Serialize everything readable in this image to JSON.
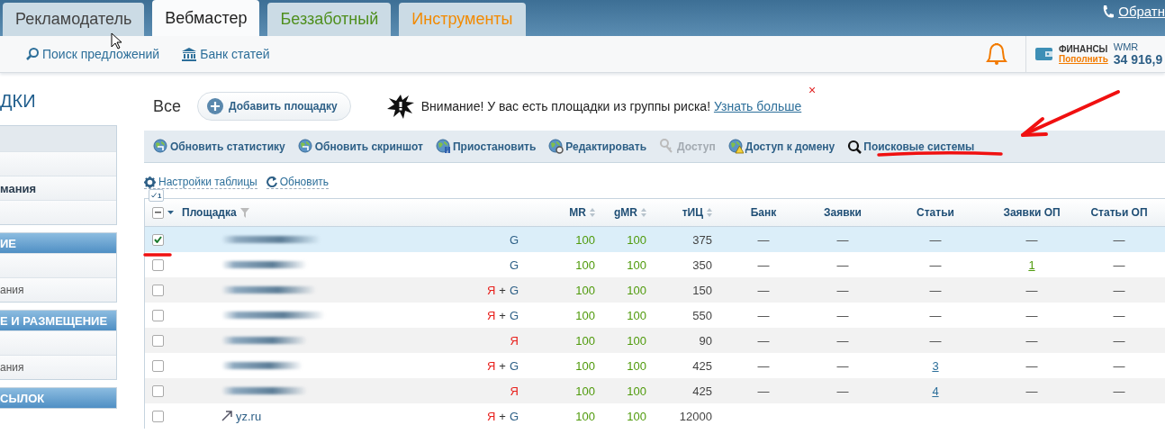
{
  "top_tabs": [
    {
      "label": "Рекламодатель",
      "selected": false,
      "kind": "plain"
    },
    {
      "label": "Вебмастер",
      "selected": true,
      "kind": "plain"
    },
    {
      "label": "Беззаботный",
      "selected": false,
      "kind": "green"
    },
    {
      "label": "Инструменты",
      "selected": false,
      "kind": "orange"
    }
  ],
  "callback_link": "Обратн",
  "subnav": [
    {
      "label": "Поиск предложений",
      "kind": "search"
    },
    {
      "label": "Банк статей",
      "kind": "bank"
    }
  ],
  "finance": {
    "title": "ФИНАНСЫ",
    "topup": "Пополнить",
    "currency": "WMR",
    "balance": "34 916,9"
  },
  "sidebar": {
    "heading": "ДКИ",
    "groups": [
      {
        "kind": "plain",
        "items": [
          {
            "kind": "head"
          },
          {
            "kind": "blank"
          },
          {
            "kind": "text",
            "label": "мания",
            "bold": true
          },
          {
            "kind": "blank"
          }
        ]
      },
      {
        "kind": "blue",
        "title": "ИЕ",
        "items": [
          {
            "kind": "blank"
          },
          {
            "kind": "text",
            "label": "ания",
            "bold": false
          }
        ]
      },
      {
        "kind": "blue",
        "title": "Е И РАЗМЕЩЕНИЕ",
        "items": [
          {
            "kind": "blank"
          },
          {
            "kind": "text",
            "label": "ания",
            "bold": false
          }
        ]
      },
      {
        "kind": "blue",
        "title": "СЫЛОК"
      }
    ]
  },
  "filter_label": "Все",
  "add_button": "Добавить площадку",
  "warning": {
    "text": "Внимание! У вас есть площадки из группы риска! ",
    "link": "Узнать больше",
    "close": "×"
  },
  "toolbar": [
    {
      "label": "Обновить статистику",
      "kind": "globe",
      "disabled": false
    },
    {
      "label": "Обновить скриншот",
      "kind": "globe",
      "disabled": false
    },
    {
      "label": "Приостановить",
      "kind": "globe-pause",
      "disabled": false
    },
    {
      "label": "Редактировать",
      "kind": "globe-gear",
      "disabled": false
    },
    {
      "label": "Доступ",
      "kind": "key",
      "disabled": true
    },
    {
      "label": "Доступ к домену",
      "kind": "globe-warning",
      "disabled": false
    },
    {
      "label": "Поисковые системы",
      "kind": "search",
      "disabled": false
    }
  ],
  "table_links": [
    {
      "label": "Настройки таблицы",
      "kind": "gear"
    },
    {
      "label": "Обновить",
      "kind": "refresh"
    }
  ],
  "table": {
    "selected_badge": "1",
    "select_all_partial": true,
    "columns": [
      {
        "label": "Площадка",
        "filter": true,
        "sortable": false
      },
      {
        "label": "MR",
        "filter": false,
        "sortable": true
      },
      {
        "label": "gMR",
        "filter": false,
        "sortable": true
      },
      {
        "label": "тИЦ",
        "filter": false,
        "sortable": true
      },
      {
        "label": "Банк",
        "filter": false,
        "sortable": false
      },
      {
        "label": "Заявки",
        "filter": false,
        "sortable": false
      },
      {
        "label": "Статьи",
        "filter": false,
        "sortable": false
      },
      {
        "label": "Заявки ОП",
        "filter": false,
        "sortable": false
      },
      {
        "label": "Статьи ОП",
        "filter": false,
        "sortable": false
      }
    ],
    "rows": [
      {
        "selected": true,
        "site": {
          "kind": "hidden"
        },
        "engines": [
          {
            "kind": "google",
            "text": "G"
          }
        ],
        "mr": "100",
        "gmr": "100",
        "tic": "375",
        "cells": [
          {
            "text": "—",
            "link": false
          },
          {
            "text": "—",
            "link": false
          },
          {
            "text": "—",
            "link": false
          },
          {
            "text": "—",
            "link": false
          },
          {
            "text": "—",
            "link": false
          }
        ]
      },
      {
        "selected": false,
        "site": {
          "kind": "hidden"
        },
        "engines": [
          {
            "kind": "google",
            "text": "G"
          }
        ],
        "mr": "100",
        "gmr": "100",
        "tic": "350",
        "cells": [
          {
            "text": "—",
            "link": false
          },
          {
            "text": "—",
            "link": false
          },
          {
            "text": "—",
            "link": false
          },
          {
            "text": "1",
            "link": true
          },
          {
            "text": "—",
            "link": false
          }
        ]
      },
      {
        "selected": false,
        "site": {
          "kind": "hidden"
        },
        "engines": [
          {
            "kind": "yandex",
            "text": "Я"
          },
          {
            "kind": "plus",
            "text": "+"
          },
          {
            "kind": "google",
            "text": "G"
          }
        ],
        "mr": "100",
        "gmr": "100",
        "tic": "150",
        "cells": [
          {
            "text": "—",
            "link": false
          },
          {
            "text": "—",
            "link": false
          },
          {
            "text": "—",
            "link": false
          },
          {
            "text": "—",
            "link": false
          },
          {
            "text": "—",
            "link": false
          }
        ]
      },
      {
        "selected": false,
        "site": {
          "kind": "hidden"
        },
        "engines": [
          {
            "kind": "yandex",
            "text": "Я"
          },
          {
            "kind": "plus",
            "text": "+"
          },
          {
            "kind": "google",
            "text": "G"
          }
        ],
        "mr": "100",
        "gmr": "100",
        "tic": "550",
        "cells": [
          {
            "text": "—",
            "link": false
          },
          {
            "text": "—",
            "link": false
          },
          {
            "text": "—",
            "link": false
          },
          {
            "text": "—",
            "link": false
          },
          {
            "text": "—",
            "link": false
          }
        ]
      },
      {
        "selected": false,
        "site": {
          "kind": "hidden"
        },
        "engines": [
          {
            "kind": "yandex",
            "text": "Я"
          }
        ],
        "mr": "100",
        "gmr": "100",
        "tic": "90",
        "cells": [
          {
            "text": "—",
            "link": false
          },
          {
            "text": "—",
            "link": false
          },
          {
            "text": "—",
            "link": false
          },
          {
            "text": "—",
            "link": false
          },
          {
            "text": "—",
            "link": false
          }
        ]
      },
      {
        "selected": false,
        "site": {
          "kind": "hidden"
        },
        "engines": [
          {
            "kind": "yandex",
            "text": "Я"
          },
          {
            "kind": "plus",
            "text": "+"
          },
          {
            "kind": "google",
            "text": "G"
          }
        ],
        "mr": "100",
        "gmr": "100",
        "tic": "425",
        "cells": [
          {
            "text": "—",
            "link": false
          },
          {
            "text": "—",
            "link": false
          },
          {
            "text": "3",
            "link": true
          },
          {
            "text": "—",
            "link": false
          },
          {
            "text": "—",
            "link": false
          }
        ]
      },
      {
        "selected": false,
        "site": {
          "kind": "hidden"
        },
        "engines": [
          {
            "kind": "yandex",
            "text": "Я"
          }
        ],
        "mr": "100",
        "gmr": "100",
        "tic": "425",
        "cells": [
          {
            "text": "—",
            "link": false
          },
          {
            "text": "—",
            "link": false
          },
          {
            "text": "4",
            "link": true
          },
          {
            "text": "—",
            "link": false
          },
          {
            "text": "—",
            "link": false
          }
        ]
      },
      {
        "selected": false,
        "site": {
          "kind": "text",
          "text": "yz.ru"
        },
        "engines": [
          {
            "kind": "yandex",
            "text": "Я"
          },
          {
            "kind": "plus",
            "text": "+"
          },
          {
            "kind": "google",
            "text": "G"
          }
        ],
        "mr": "100",
        "gmr": "100",
        "tic": "12000"
      }
    ]
  }
}
